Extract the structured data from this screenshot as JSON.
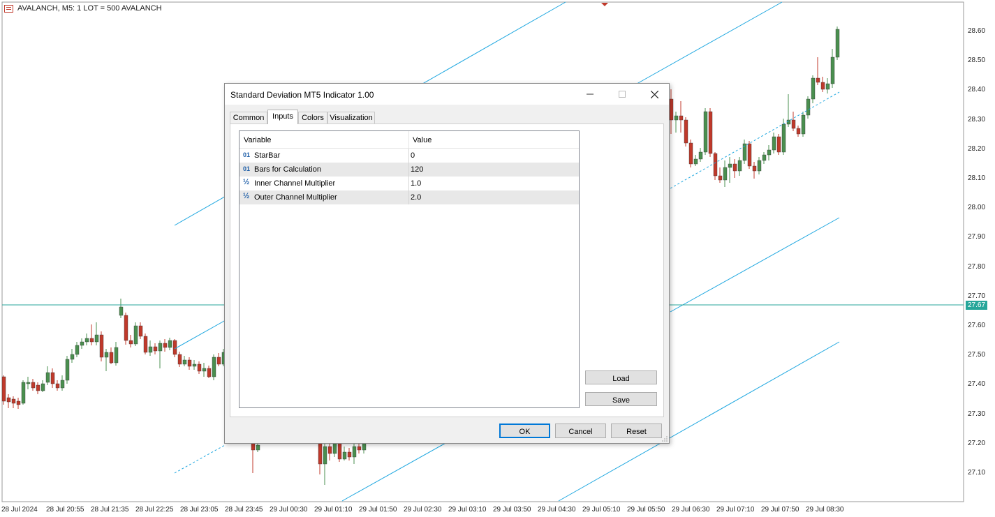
{
  "chart": {
    "header": "AVALANCH, M5:  1 LOT = 500 AVALANCH",
    "price_labels": [
      "28.60",
      "28.50",
      "28.40",
      "28.30",
      "28.20",
      "28.10",
      "28.00",
      "27.90",
      "27.80",
      "27.70",
      "27.60",
      "27.50",
      "27.40",
      "27.30",
      "27.20",
      "27.10"
    ],
    "current_price": "27.67",
    "time_labels": [
      "28 Jul 2024",
      "28 Jul 20:55",
      "28 Jul 21:35",
      "28 Jul 22:25",
      "28 Jul 23:05",
      "28 Jul 23:45",
      "29 Jul 00:30",
      "29 Jul 01:10",
      "29 Jul 01:50",
      "29 Jul 02:30",
      "29 Jul 03:10",
      "29 Jul 03:50",
      "29 Jul 04:30",
      "29 Jul 05:10",
      "29 Jul 05:50",
      "29 Jul 06:30",
      "29 Jul 07:10",
      "29 Jul 07:50",
      "29 Jul 08:30"
    ],
    "colors": {
      "bull": "#4a8f4f",
      "bear": "#c0392b",
      "channel": "#1ea7e0",
      "grid": "#d0d0d0"
    }
  },
  "dialog": {
    "title": "Standard Deviation MT5 Indicator 1.00",
    "tabs": [
      "Common",
      "Inputs",
      "Colors",
      "Visualization"
    ],
    "active_tab": "Inputs",
    "columns": {
      "variable": "Variable",
      "value": "Value"
    },
    "rows": [
      {
        "type": "01",
        "name": "StarBar",
        "value": "0"
      },
      {
        "type": "01",
        "name": "Bars for Calculation",
        "value": "120"
      },
      {
        "type": "½",
        "name": "Inner Channel Multiplier",
        "value": "1.0"
      },
      {
        "type": "½",
        "name": "Outer Channel Multiplier",
        "value": "2.0"
      }
    ],
    "buttons": {
      "load": "Load",
      "save": "Save",
      "ok": "OK",
      "cancel": "Cancel",
      "reset": "Reset"
    }
  }
}
